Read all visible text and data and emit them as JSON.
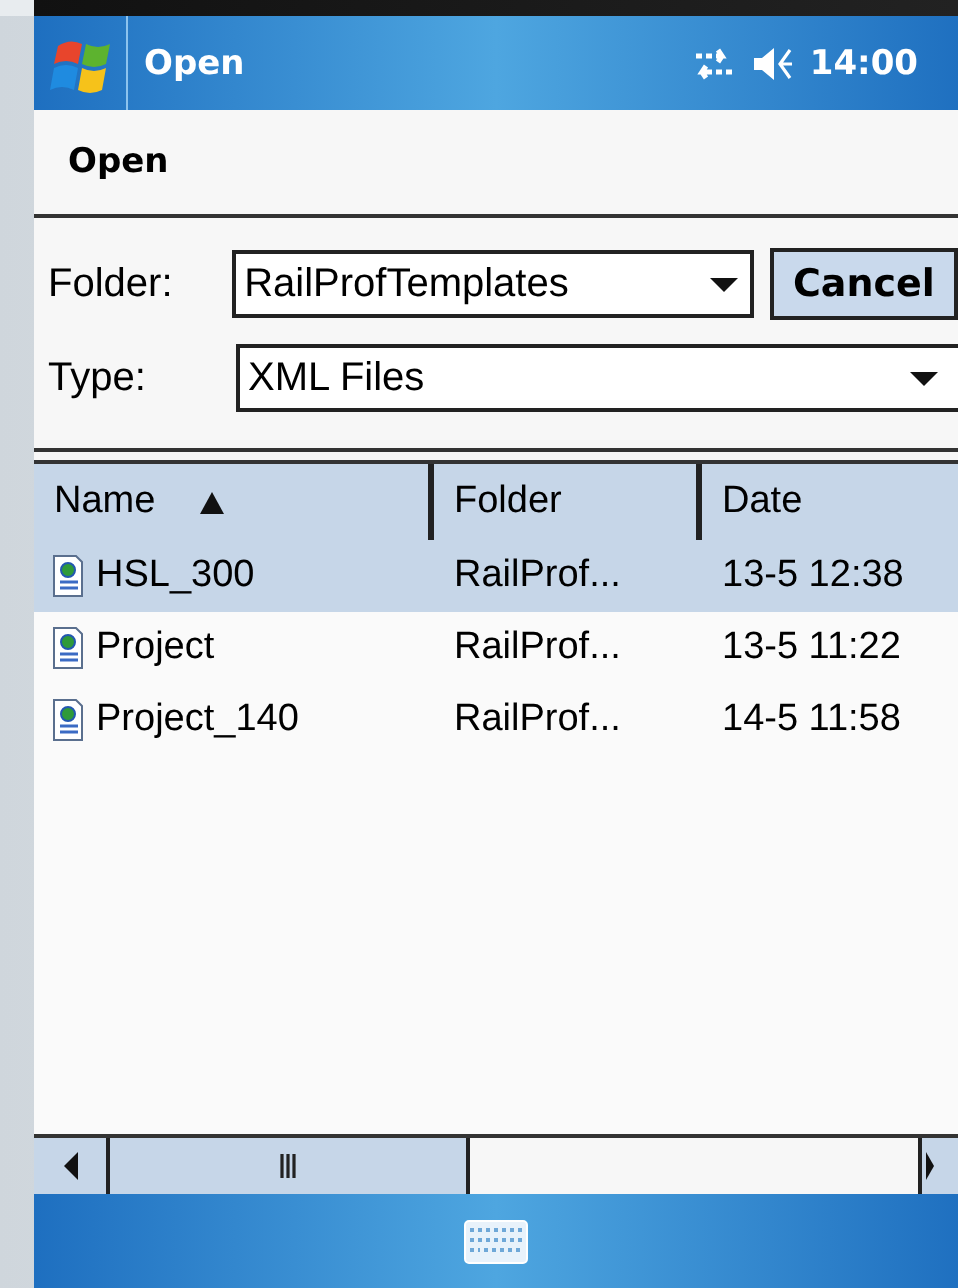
{
  "title_bar": {
    "title": "Open",
    "time": "14:00"
  },
  "header": {
    "title": "Open"
  },
  "folder": {
    "label": "Folder:",
    "value": "RailProfTemplates"
  },
  "cancel_button": {
    "label": "Cancel"
  },
  "type": {
    "label": "Type:",
    "value": "XML Files"
  },
  "file_list": {
    "columns": [
      {
        "label": "Name",
        "sorted": true
      },
      {
        "label": "Folder",
        "sorted": false
      },
      {
        "label": "Date",
        "sorted": false
      }
    ],
    "rows": [
      {
        "name": "HSL_300",
        "folder": "RailProf...",
        "date": "13-5 12:38",
        "selected": true
      },
      {
        "name": "Project",
        "folder": "RailProf...",
        "date": "13-5 11:22",
        "selected": false
      },
      {
        "name": "Project_140",
        "folder": "RailProf...",
        "date": "14-5 11:58",
        "selected": false
      }
    ]
  }
}
